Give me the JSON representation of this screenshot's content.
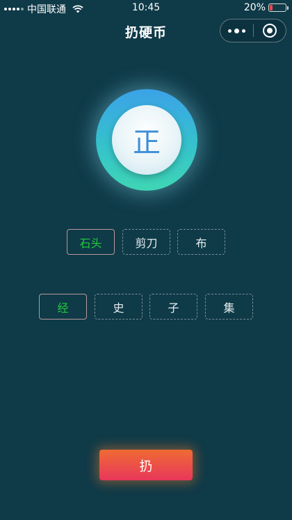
{
  "status_bar": {
    "carrier": "中国联通",
    "time": "10:45",
    "battery_percent": "20%",
    "battery_level": 0.2
  },
  "header": {
    "title": "扔硬币"
  },
  "coin": {
    "face_text": "正"
  },
  "game_options": [
    {
      "label": "石头",
      "selected": true
    },
    {
      "label": "剪刀",
      "selected": false
    },
    {
      "label": "布",
      "selected": false
    }
  ],
  "book_options": [
    {
      "label": "经",
      "selected": true
    },
    {
      "label": "史",
      "selected": false
    },
    {
      "label": "子",
      "selected": false
    },
    {
      "label": "集",
      "selected": false
    }
  ],
  "throw_button": {
    "label": "扔"
  },
  "colors": {
    "background": "#0f3a48",
    "selected_text": "#1fcf3a",
    "button_gradient_top": "#ef6b34",
    "button_gradient_bottom": "#e8375a",
    "coin_text": "#3d8fd6"
  }
}
